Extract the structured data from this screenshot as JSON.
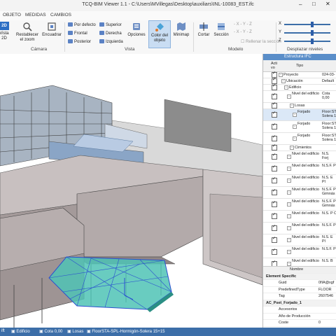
{
  "window": {
    "title": "TCQ-BIM Viewer 1.1 - C:\\Users\\MVillegas\\Desktop\\auxiliars\\INL-10083_EST.ifc"
  },
  "menu": [
    "OBJETO",
    "MEDIDAS",
    "CAMBIOS"
  ],
  "ribbon": {
    "vista2d_badge": "2D",
    "vista2d_label": "Vista 2D",
    "restablecer": "Restablecer el zoom",
    "encuadrar": "Encuadrar",
    "por_defecto": "Por defecto",
    "frontal": "Frontal",
    "posterior": "Posterior",
    "superior": "Superior",
    "derecha": "Derecha",
    "izquierda": "Izquierda",
    "opciones": "Opciones",
    "color_objeto": "Color del objeto",
    "minimap": "Minimap",
    "cortar": "Cortar",
    "seccion": "Sección",
    "rellenar": "Rellenar la sección",
    "x_buttons": "- X  - Y  - Z",
    "x_buttons2": "- X  - Y  - Z",
    "axis_x": "X",
    "axis_y": "Y",
    "axis_z": "Z",
    "slider_x": 0.6,
    "slider_y": 0.6,
    "slider_z": 0.6,
    "groups": {
      "camara": "Cámara",
      "vista": "Vista",
      "modelo": "Modelo",
      "desplazar": "Desplazar niveles"
    }
  },
  "panel": {
    "header": "Estructura IFC",
    "col_activo": "Acti vo",
    "col_tipo": "Tipo",
    "rows": [
      {
        "label": "Proyecto",
        "value": "024-03-",
        "indent": 0
      },
      {
        "label": "Ubicación",
        "value": "Default",
        "indent": 1
      },
      {
        "label": "Edificio",
        "value": "",
        "indent": 2
      },
      {
        "label": "Nivel del edificio",
        "value": "Cota 0,00",
        "indent": 3
      },
      {
        "label": "Losas",
        "value": "",
        "indent": 4
      },
      {
        "label": "Forjado",
        "value": "Floor:STA-Solera 1",
        "indent": 5
      },
      {
        "label": "Forjado",
        "value": "Floor:STA-Solera 1",
        "indent": 5
      },
      {
        "label": "Forjado",
        "value": "Floor:STA-Solera 1",
        "indent": 5
      },
      {
        "label": "Cimientos",
        "value": "",
        "indent": 4
      },
      {
        "label": "Nivel del edificio",
        "value": "N.S. Forj",
        "indent": 3
      },
      {
        "label": "Nivel del edificio",
        "value": "N.S.F. P",
        "indent": 3
      },
      {
        "label": "Nivel del edificio",
        "value": "N.S. E Pl",
        "indent": 3
      },
      {
        "label": "Nivel del edificio",
        "value": "N.S.F. Pl Gimnás",
        "indent": 3
      },
      {
        "label": "Nivel del edificio",
        "value": "N.S.F. Pl Gimnás",
        "indent": 3
      },
      {
        "label": "Nivel del edificio",
        "value": "N.S. P C",
        "indent": 3
      },
      {
        "label": "Nivel del edificio",
        "value": "N.S.F. P",
        "indent": 3
      },
      {
        "label": "Nivel del edificio",
        "value": "N.S. E Pl",
        "indent": 3
      },
      {
        "label": "Nivel del edificio",
        "value": "N.S.F. Pl",
        "indent": 3
      },
      {
        "label": "Nivel del edificio",
        "value": "N.S. B",
        "indent": 3
      }
    ],
    "props_header": "Nombre",
    "props": [
      {
        "section": "Element Specific"
      },
      {
        "k": "Guid",
        "v": "0fIA@xgf"
      },
      {
        "k": "PredefinedType",
        "v": "FLOOR"
      },
      {
        "k": "Tag",
        "v": "2607546"
      },
      {
        "section": "AC_Pset_Forjado_1"
      },
      {
        "k": "Accesorios",
        "v": ""
      },
      {
        "k": "Año de Producción",
        "v": ""
      },
      {
        "k": "Coste",
        "v": "0"
      }
    ]
  },
  "status": {
    "items": [
      "Edificio",
      "Cota 0,00",
      "Losas",
      "FloorSTA-SPL-Hormigón-Solera 15+15"
    ],
    "left": "ift"
  },
  "colors": {
    "accent": "#3c6ea8",
    "selection": "#4fc3b5",
    "header": "#5a8ec9"
  }
}
